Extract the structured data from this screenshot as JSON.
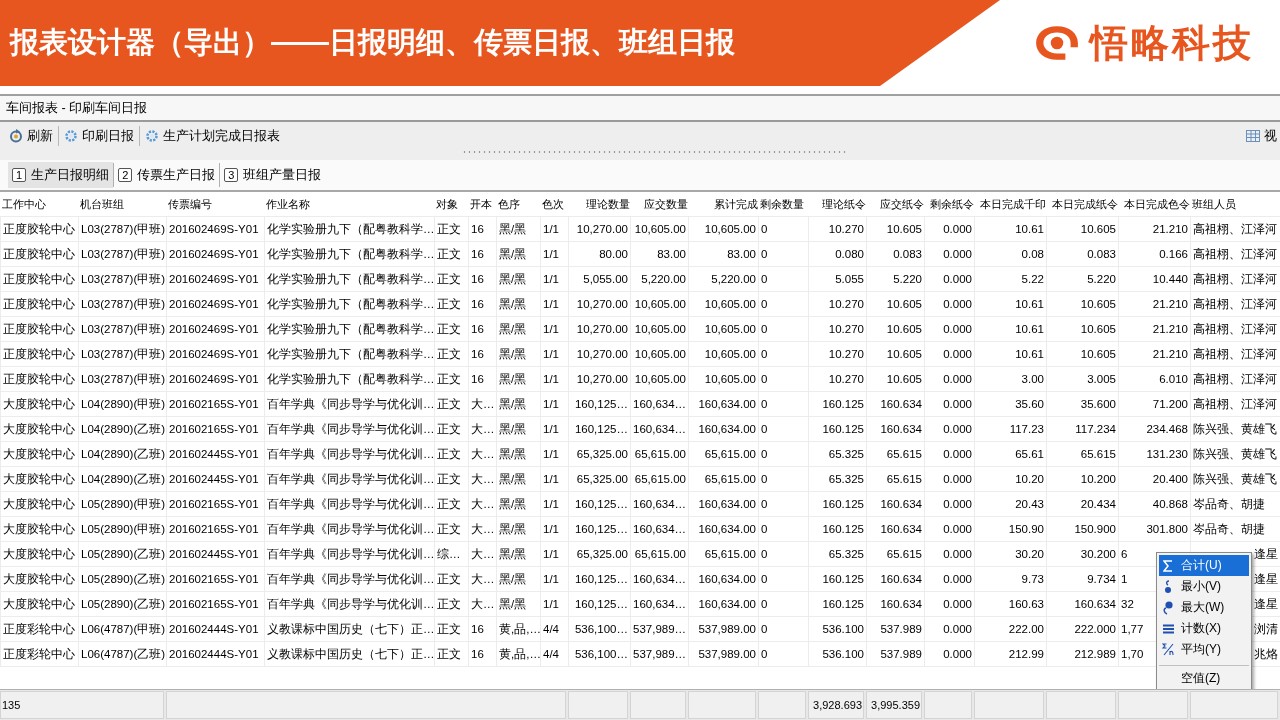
{
  "slide_title": "报表设计器（导出）——日报明细、传票日报、班组日报",
  "brand": "悟略科技",
  "window": {
    "title": "车间报表 - 印刷车间日报"
  },
  "toolbar": [
    {
      "kind": "refresh",
      "label": "刷新"
    },
    {
      "kind": "gear",
      "label": "印刷日报"
    },
    {
      "kind": "gear",
      "label": "生产计划完成日报表"
    }
  ],
  "toolbar_right": {
    "label": "视"
  },
  "tabs": [
    {
      "number": "1",
      "label": "生产日报明细",
      "selected": true
    },
    {
      "number": "2",
      "label": "传票生产日报",
      "selected": false
    },
    {
      "number": "3",
      "label": "班组产量日报",
      "selected": false
    }
  ],
  "table": {
    "columns": [
      "工作中心",
      "机台班组",
      "传票编号",
      "作业名称",
      "对象",
      "开本",
      "色序",
      "色次",
      "理论数量",
      "应交数量",
      "累计完成",
      "剩余数量",
      "理论纸令",
      "应交纸令",
      "剩余纸令",
      "本日完成千印",
      "本日完成纸令",
      "本日完成色令",
      "班组人员"
    ],
    "rows": [
      {
        "covered": false,
        "cells": [
          "正度胶轮中心",
          "L03(2787)(甲班)",
          "201602469S-Y01",
          "化学实验册九下（配粤教科学…",
          "正文",
          "16",
          "黑/黑",
          "1/1",
          "10,270.00",
          "10,605.00",
          "10,605.00",
          "0",
          "10.270",
          "10.605",
          "0.000",
          "10.61",
          "10.605",
          "21.210",
          "高祖栩、江泽河"
        ]
      },
      {
        "covered": false,
        "cells": [
          "正度胶轮中心",
          "L03(2787)(甲班)",
          "201602469S-Y01",
          "化学实验册九下（配粤教科学…",
          "正文",
          "16",
          "黑/黑",
          "1/1",
          "80.00",
          "83.00",
          "83.00",
          "0",
          "0.080",
          "0.083",
          "0.000",
          "0.08",
          "0.083",
          "0.166",
          "高祖栩、江泽河"
        ]
      },
      {
        "covered": false,
        "cells": [
          "正度胶轮中心",
          "L03(2787)(甲班)",
          "201602469S-Y01",
          "化学实验册九下（配粤教科学…",
          "正文",
          "16",
          "黑/黑",
          "1/1",
          "5,055.00",
          "5,220.00",
          "5,220.00",
          "0",
          "5.055",
          "5.220",
          "0.000",
          "5.22",
          "5.220",
          "10.440",
          "高祖栩、江泽河"
        ]
      },
      {
        "covered": false,
        "cells": [
          "正度胶轮中心",
          "L03(2787)(甲班)",
          "201602469S-Y01",
          "化学实验册九下（配粤教科学…",
          "正文",
          "16",
          "黑/黑",
          "1/1",
          "10,270.00",
          "10,605.00",
          "10,605.00",
          "0",
          "10.270",
          "10.605",
          "0.000",
          "10.61",
          "10.605",
          "21.210",
          "高祖栩、江泽河"
        ]
      },
      {
        "covered": false,
        "cells": [
          "正度胶轮中心",
          "L03(2787)(甲班)",
          "201602469S-Y01",
          "化学实验册九下（配粤教科学…",
          "正文",
          "16",
          "黑/黑",
          "1/1",
          "10,270.00",
          "10,605.00",
          "10,605.00",
          "0",
          "10.270",
          "10.605",
          "0.000",
          "10.61",
          "10.605",
          "21.210",
          "高祖栩、江泽河"
        ]
      },
      {
        "covered": false,
        "cells": [
          "正度胶轮中心",
          "L03(2787)(甲班)",
          "201602469S-Y01",
          "化学实验册九下（配粤教科学…",
          "正文",
          "16",
          "黑/黑",
          "1/1",
          "10,270.00",
          "10,605.00",
          "10,605.00",
          "0",
          "10.270",
          "10.605",
          "0.000",
          "10.61",
          "10.605",
          "21.210",
          "高祖栩、江泽河"
        ]
      },
      {
        "covered": false,
        "cells": [
          "正度胶轮中心",
          "L03(2787)(甲班)",
          "201602469S-Y01",
          "化学实验册九下（配粤教科学…",
          "正文",
          "16",
          "黑/黑",
          "1/1",
          "10,270.00",
          "10,605.00",
          "10,605.00",
          "0",
          "10.270",
          "10.605",
          "0.000",
          "3.00",
          "3.005",
          "6.010",
          "高祖栩、江泽河"
        ]
      },
      {
        "covered": false,
        "cells": [
          "大度胶轮中心",
          "L04(2890)(甲班)",
          "201602165S-Y01",
          "百年学典《同步导学与优化训…",
          "正文",
          "大…",
          "黑/黑",
          "1/1",
          "160,125…",
          "160,634…",
          "160,634.00",
          "0",
          "160.125",
          "160.634",
          "0.000",
          "35.60",
          "35.600",
          "71.200",
          "高祖栩、江泽河"
        ]
      },
      {
        "covered": false,
        "cells": [
          "大度胶轮中心",
          "L04(2890)(乙班)",
          "201602165S-Y01",
          "百年学典《同步导学与优化训…",
          "正文",
          "大…",
          "黑/黑",
          "1/1",
          "160,125…",
          "160,634…",
          "160,634.00",
          "0",
          "160.125",
          "160.634",
          "0.000",
          "117.23",
          "117.234",
          "234.468",
          "陈兴强、黄雄飞"
        ]
      },
      {
        "covered": false,
        "cells": [
          "大度胶轮中心",
          "L04(2890)(乙班)",
          "201602445S-Y01",
          "百年学典《同步导学与优化训…",
          "正文",
          "大…",
          "黑/黑",
          "1/1",
          "65,325.00",
          "65,615.00",
          "65,615.00",
          "0",
          "65.325",
          "65.615",
          "0.000",
          "65.61",
          "65.615",
          "131.230",
          "陈兴强、黄雄飞"
        ]
      },
      {
        "covered": false,
        "cells": [
          "大度胶轮中心",
          "L04(2890)(乙班)",
          "201602445S-Y01",
          "百年学典《同步导学与优化训…",
          "正文",
          "大…",
          "黑/黑",
          "1/1",
          "65,325.00",
          "65,615.00",
          "65,615.00",
          "0",
          "65.325",
          "65.615",
          "0.000",
          "10.20",
          "10.200",
          "20.400",
          "陈兴强、黄雄飞"
        ]
      },
      {
        "covered": false,
        "cells": [
          "大度胶轮中心",
          "L05(2890)(甲班)",
          "201602165S-Y01",
          "百年学典《同步导学与优化训…",
          "正文",
          "大…",
          "黑/黑",
          "1/1",
          "160,125…",
          "160,634…",
          "160,634.00",
          "0",
          "160.125",
          "160.634",
          "0.000",
          "20.43",
          "20.434",
          "40.868",
          "岑品奇、胡捷"
        ]
      },
      {
        "covered": false,
        "cells": [
          "大度胶轮中心",
          "L05(2890)(甲班)",
          "201602165S-Y01",
          "百年学典《同步导学与优化训…",
          "正文",
          "大…",
          "黑/黑",
          "1/1",
          "160,125…",
          "160,634…",
          "160,634.00",
          "0",
          "160.125",
          "160.634",
          "0.000",
          "150.90",
          "150.900",
          "301.800",
          "岑品奇、胡捷"
        ]
      },
      {
        "covered": true,
        "cells": [
          "大度胶轮中心",
          "L05(2890)(乙班)",
          "201602445S-Y01",
          "百年学典《同步导学与优化训…",
          "综…",
          "大…",
          "黑/黑",
          "1/1",
          "65,325.00",
          "65,615.00",
          "65,615.00",
          "0",
          "65.325",
          "65.615",
          "0.000",
          "30.20",
          "30.200",
          "6",
          "逢星"
        ]
      },
      {
        "covered": true,
        "cells": [
          "大度胶轮中心",
          "L05(2890)(乙班)",
          "201602165S-Y01",
          "百年学典《同步导学与优化训…",
          "正文",
          "大…",
          "黑/黑",
          "1/1",
          "160,125…",
          "160,634…",
          "160,634.00",
          "0",
          "160.125",
          "160.634",
          "0.000",
          "9.73",
          "9.734",
          "1",
          "逢星"
        ]
      },
      {
        "covered": true,
        "cells": [
          "大度胶轮中心",
          "L05(2890)(乙班)",
          "201602165S-Y01",
          "百年学典《同步导学与优化训…",
          "正文",
          "大…",
          "黑/黑",
          "1/1",
          "160,125…",
          "160,634…",
          "160,634.00",
          "0",
          "160.125",
          "160.634",
          "0.000",
          "160.63",
          "160.634",
          "32",
          "逢星"
        ]
      },
      {
        "covered": true,
        "cells": [
          "正度彩轮中心",
          "L06(4787)(甲班)",
          "201602444S-Y01",
          "义教课标中国历史（七下）正…",
          "正文",
          "16",
          "黄,品,…",
          "4/4",
          "536,100…",
          "537,989…",
          "537,989.00",
          "0",
          "536.100",
          "537.989",
          "0.000",
          "222.00",
          "222.000",
          "1,77",
          "浏清"
        ]
      },
      {
        "covered": true,
        "cells": [
          "正度彩轮中心",
          "L06(4787)(乙班)",
          "201602444S-Y01",
          "义教课标中国历史（七下）正…",
          "正文",
          "16",
          "黄,品,…",
          "4/4",
          "536,100…",
          "537,989…",
          "537,989.00",
          "0",
          "536.100",
          "537.989",
          "0.000",
          "212.99",
          "212.989",
          "1,70",
          "兆烙"
        ]
      }
    ]
  },
  "status_bar": {
    "count": "135",
    "sums": [
      "3,928.693",
      "3,995.359"
    ]
  },
  "context_menu": [
    {
      "kind": "sum",
      "label": "合计(U)",
      "selected": true,
      "divider": false
    },
    {
      "kind": "min",
      "label": "最小(V)",
      "selected": false,
      "divider": false
    },
    {
      "kind": "max",
      "label": "最大(W)",
      "selected": false,
      "divider": false
    },
    {
      "kind": "count",
      "label": "计数(X)",
      "selected": false,
      "divider": false
    },
    {
      "kind": "avg",
      "label": "平均(Y)",
      "selected": false,
      "divider": false
    },
    {
      "kind": "none",
      "label": "空值(Z)",
      "selected": false,
      "divider": true
    }
  ]
}
